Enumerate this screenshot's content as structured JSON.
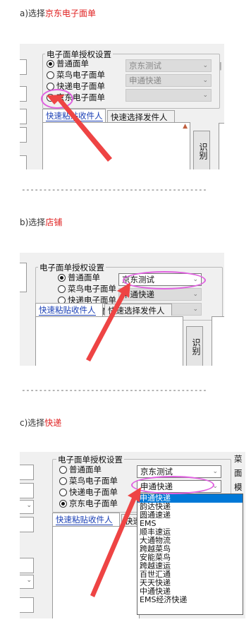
{
  "steps": [
    {
      "label": "a)选择",
      "highlight": "京东电子面单"
    },
    {
      "label": "b)选择",
      "highlight": "店铺"
    },
    {
      "label": "c)选择",
      "highlight": "快递"
    }
  ],
  "separator": "-------------------------------------------",
  "settings": {
    "group_title": "电子面单授权设置",
    "options": [
      "普通面单",
      "菜鸟电子面单",
      "快递电子面单",
      "京东电子面单"
    ],
    "shop_value": "京东测试",
    "express_value": "申通快递",
    "tabs": [
      "快速粘贴收件人",
      "快速选择发件人"
    ],
    "recognize_label": "识别",
    "side_labels": [
      "菜",
      "面",
      "模"
    ]
  },
  "express_options": [
    "申通快递",
    "韵达快递",
    "圆通速递",
    "EMS",
    "顺丰速运",
    "大通物流",
    "跨越菜鸟",
    "安能菜鸟",
    "跨越速运",
    "百世汇通",
    "天天快递",
    "中通快递",
    "EMS经济快递"
  ],
  "colors": {
    "highlight_text": "#e02020",
    "ellipse": "#e060e0",
    "arrow": "#ee4444",
    "selected": "#0078d7",
    "tab_active": "#1a3fb5"
  }
}
